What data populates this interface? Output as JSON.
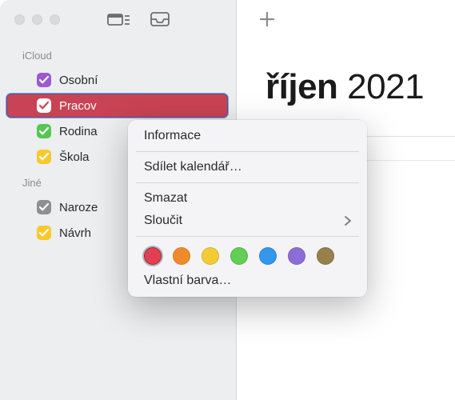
{
  "month": {
    "name": "říjen",
    "year": "2021"
  },
  "sidebar": {
    "groups": [
      {
        "title": "iCloud",
        "items": [
          {
            "label": "Osobní",
            "color": "#9d59d0",
            "selected": false
          },
          {
            "label": "Pracov",
            "color": "#ffffff",
            "selected": true,
            "bg": "#c84354"
          },
          {
            "label": "Rodina",
            "color": "#55c654",
            "selected": false
          },
          {
            "label": "Škola",
            "color": "#f8c92a",
            "selected": false
          }
        ]
      },
      {
        "title": "Jiné",
        "items": [
          {
            "label": "Naroze",
            "color": "#8e8e93",
            "selected": false
          },
          {
            "label": "Návrh",
            "color": "#f8c92a",
            "selected": false
          }
        ]
      }
    ]
  },
  "context_menu": {
    "info": "Informace",
    "share": "Sdílet kalendář…",
    "delete": "Smazat",
    "merge": "Sloučit",
    "custom_color": "Vlastní barva…",
    "colors": [
      {
        "hex": "#e24052",
        "selected": true
      },
      {
        "hex": "#ef8b2d"
      },
      {
        "hex": "#f4cb34"
      },
      {
        "hex": "#63cd55"
      },
      {
        "hex": "#3695ed"
      },
      {
        "hex": "#8a6dd6"
      },
      {
        "hex": "#97804b"
      }
    ]
  }
}
